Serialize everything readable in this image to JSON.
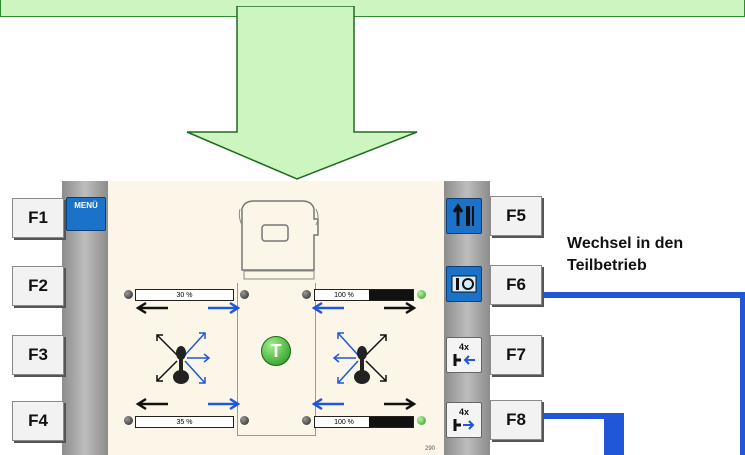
{
  "keys_left": [
    "F1",
    "F2",
    "F3",
    "F4"
  ],
  "keys_right": [
    "F5",
    "F6",
    "F7",
    "F8"
  ],
  "menu_label": "MENÜ",
  "bars": {
    "left_top": "30 %",
    "left_bottom": "35 %",
    "right_top": "100 %",
    "right_bottom": "100 %"
  },
  "center_badge": "T",
  "icons": {
    "f7_top": "4x",
    "f8_top": "4x"
  },
  "screen_code": "290",
  "annotation": {
    "line1": "Wechsel in den",
    "line2": "Teilbetrieb"
  },
  "colors": {
    "top_bar": "#ccf5c0",
    "arrow_fill": "#ccf5c0",
    "arrow_stroke": "#1f6b1f",
    "accent_line": "#1f57d8",
    "menu_button": "#1a73c8"
  }
}
